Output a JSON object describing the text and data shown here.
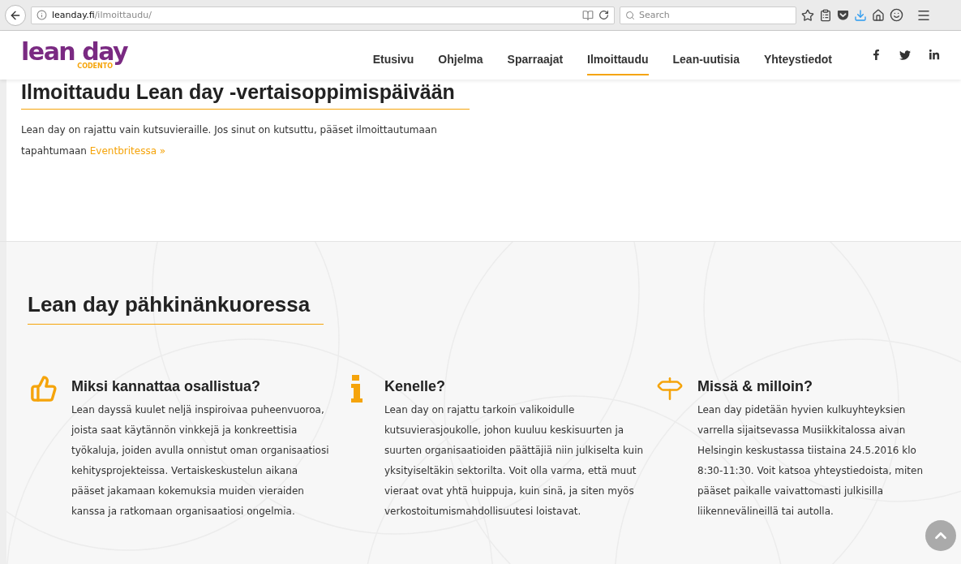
{
  "browser": {
    "url_host": "leanday.fi",
    "url_path": "/ilmoittaudu/",
    "search_placeholder": "Search"
  },
  "logo": {
    "wordmark": "lean day",
    "sub": "CODENTO"
  },
  "nav": [
    {
      "label": "Etusivu",
      "selected": false
    },
    {
      "label": "Ohjelma",
      "selected": false
    },
    {
      "label": "Sparraajat",
      "selected": false
    },
    {
      "label": "Ilmoittaudu",
      "selected": true
    },
    {
      "label": "Lean-uutisia",
      "selected": false
    },
    {
      "label": "Yhteystiedot",
      "selected": false
    }
  ],
  "intro": {
    "title": "Ilmoittaudu Lean day -vertaisoppimispäivään",
    "text": "Lean day on rajattu vain kutsuvieraille. Jos sinut on kutsuttu, pääset ilmoittautumaan tapahtumaan",
    "link": "Eventbritessa »"
  },
  "summary": {
    "title": "Lean day pähkinänkuoressa",
    "features": [
      {
        "title": "Miksi kannattaa osallistua?",
        "text": "Lean dayssä kuulet neljä inspiroivaa puheenvuoroa, joista saat käytännön vinkkejä ja konkreettisia työkaluja, joiden avulla onnistut oman organisaatiosi kehitysprojekteissa. Vertaiskeskustelun aikana pääset jakamaan kokemuksia muiden vieraiden kanssa ja ratkomaan organisaatiosi ongelmia."
      },
      {
        "title": "Kenelle?",
        "text": "Lean day on rajattu tarkoin valikoidulle kutsuvierasjoukolle, johon kuuluu keskisuurten ja suurten organisaatioiden päättäjiä niin julkiselta kuin yksityiseltäkin sektorilta. Voit olla varma, että muut vieraat ovat yhtä huippuja, kuin sinä, ja siten myös verkostoitumismahdollisuutesi loistavat."
      },
      {
        "title": "Missä & milloin?",
        "text": "Lean day pidetään hyvien kulkuyhteyksien varrella sijaitsevassa Musiikkitalossa aivan Helsingin keskustassa tiistaina 24.5.2016 klo 8:30-11:30. Voit katsoa yhteystiedoista, miten pääset paikalle vaivattomasti julkisilla liikennevälineillä tai autolla."
      }
    ]
  }
}
